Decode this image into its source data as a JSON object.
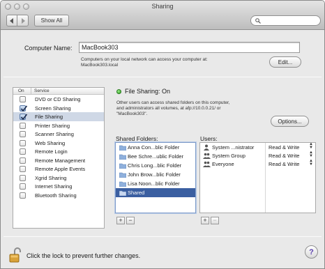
{
  "window": {
    "title": "Sharing"
  },
  "toolbar": {
    "back_icon": "chevron-left-icon",
    "forward_icon": "chevron-right-icon",
    "show_all_label": "Show All",
    "search": {
      "placeholder": "",
      "icon": "search-icon"
    }
  },
  "computer_name": {
    "label": "Computer Name:",
    "value": "MacBook303",
    "note_line1": "Computers on your local network can access your computer at:",
    "note_line2": "MacBook303.local",
    "edit_label": "Edit..."
  },
  "services": {
    "header_on": "On",
    "header_service": "Service",
    "items": [
      {
        "label": "DVD or CD Sharing",
        "checked": false
      },
      {
        "label": "Screen Sharing",
        "checked": true
      },
      {
        "label": "File Sharing",
        "checked": true,
        "selected": true
      },
      {
        "label": "Printer Sharing",
        "checked": false
      },
      {
        "label": "Scanner Sharing",
        "checked": false
      },
      {
        "label": "Web Sharing",
        "checked": false
      },
      {
        "label": "Remote Login",
        "checked": false
      },
      {
        "label": "Remote Management",
        "checked": false
      },
      {
        "label": "Remote Apple Events",
        "checked": false
      },
      {
        "label": "Xgrid Sharing",
        "checked": false
      },
      {
        "label": "Internet Sharing",
        "checked": false
      },
      {
        "label": "Bluetooth Sharing",
        "checked": false
      }
    ]
  },
  "file_sharing": {
    "status": "File Sharing: On",
    "status_color": "#2c9a1d",
    "desc_line1": "Other users can access shared folders on this computer,",
    "desc_line2": "and administrators all volumes, at afp://10.0.0.21/ or",
    "desc_line3": "\"MacBook303\".",
    "options_label": "Options...",
    "shared_folders_label": "Shared Folders:",
    "users_label": "Users:",
    "folders": [
      {
        "name": "Anna Con...blic Folder",
        "selected": false
      },
      {
        "name": "Bee Schre...ublic Folder",
        "selected": false
      },
      {
        "name": "Chris Long...blic Folder",
        "selected": false
      },
      {
        "name": "John Brow...blic Folder",
        "selected": false
      },
      {
        "name": "Lisa Noon...blic Folder",
        "selected": false
      },
      {
        "name": "Shared",
        "selected": true
      }
    ],
    "users": [
      {
        "name": "System ...nistrator",
        "permission": "Read & Write",
        "icon": "user-icon"
      },
      {
        "name": "System Group",
        "permission": "Read & Write",
        "icon": "group-icon"
      },
      {
        "name": "Everyone",
        "permission": "Read & Write",
        "icon": "group-icon"
      }
    ],
    "add_label": "+",
    "remove_label": "−"
  },
  "footer": {
    "lock_text": "Click the lock to prevent further changes.",
    "help_label": "?"
  },
  "colors": {
    "selection": "#3b5fa1",
    "list_selection": "#cfd8e6"
  }
}
